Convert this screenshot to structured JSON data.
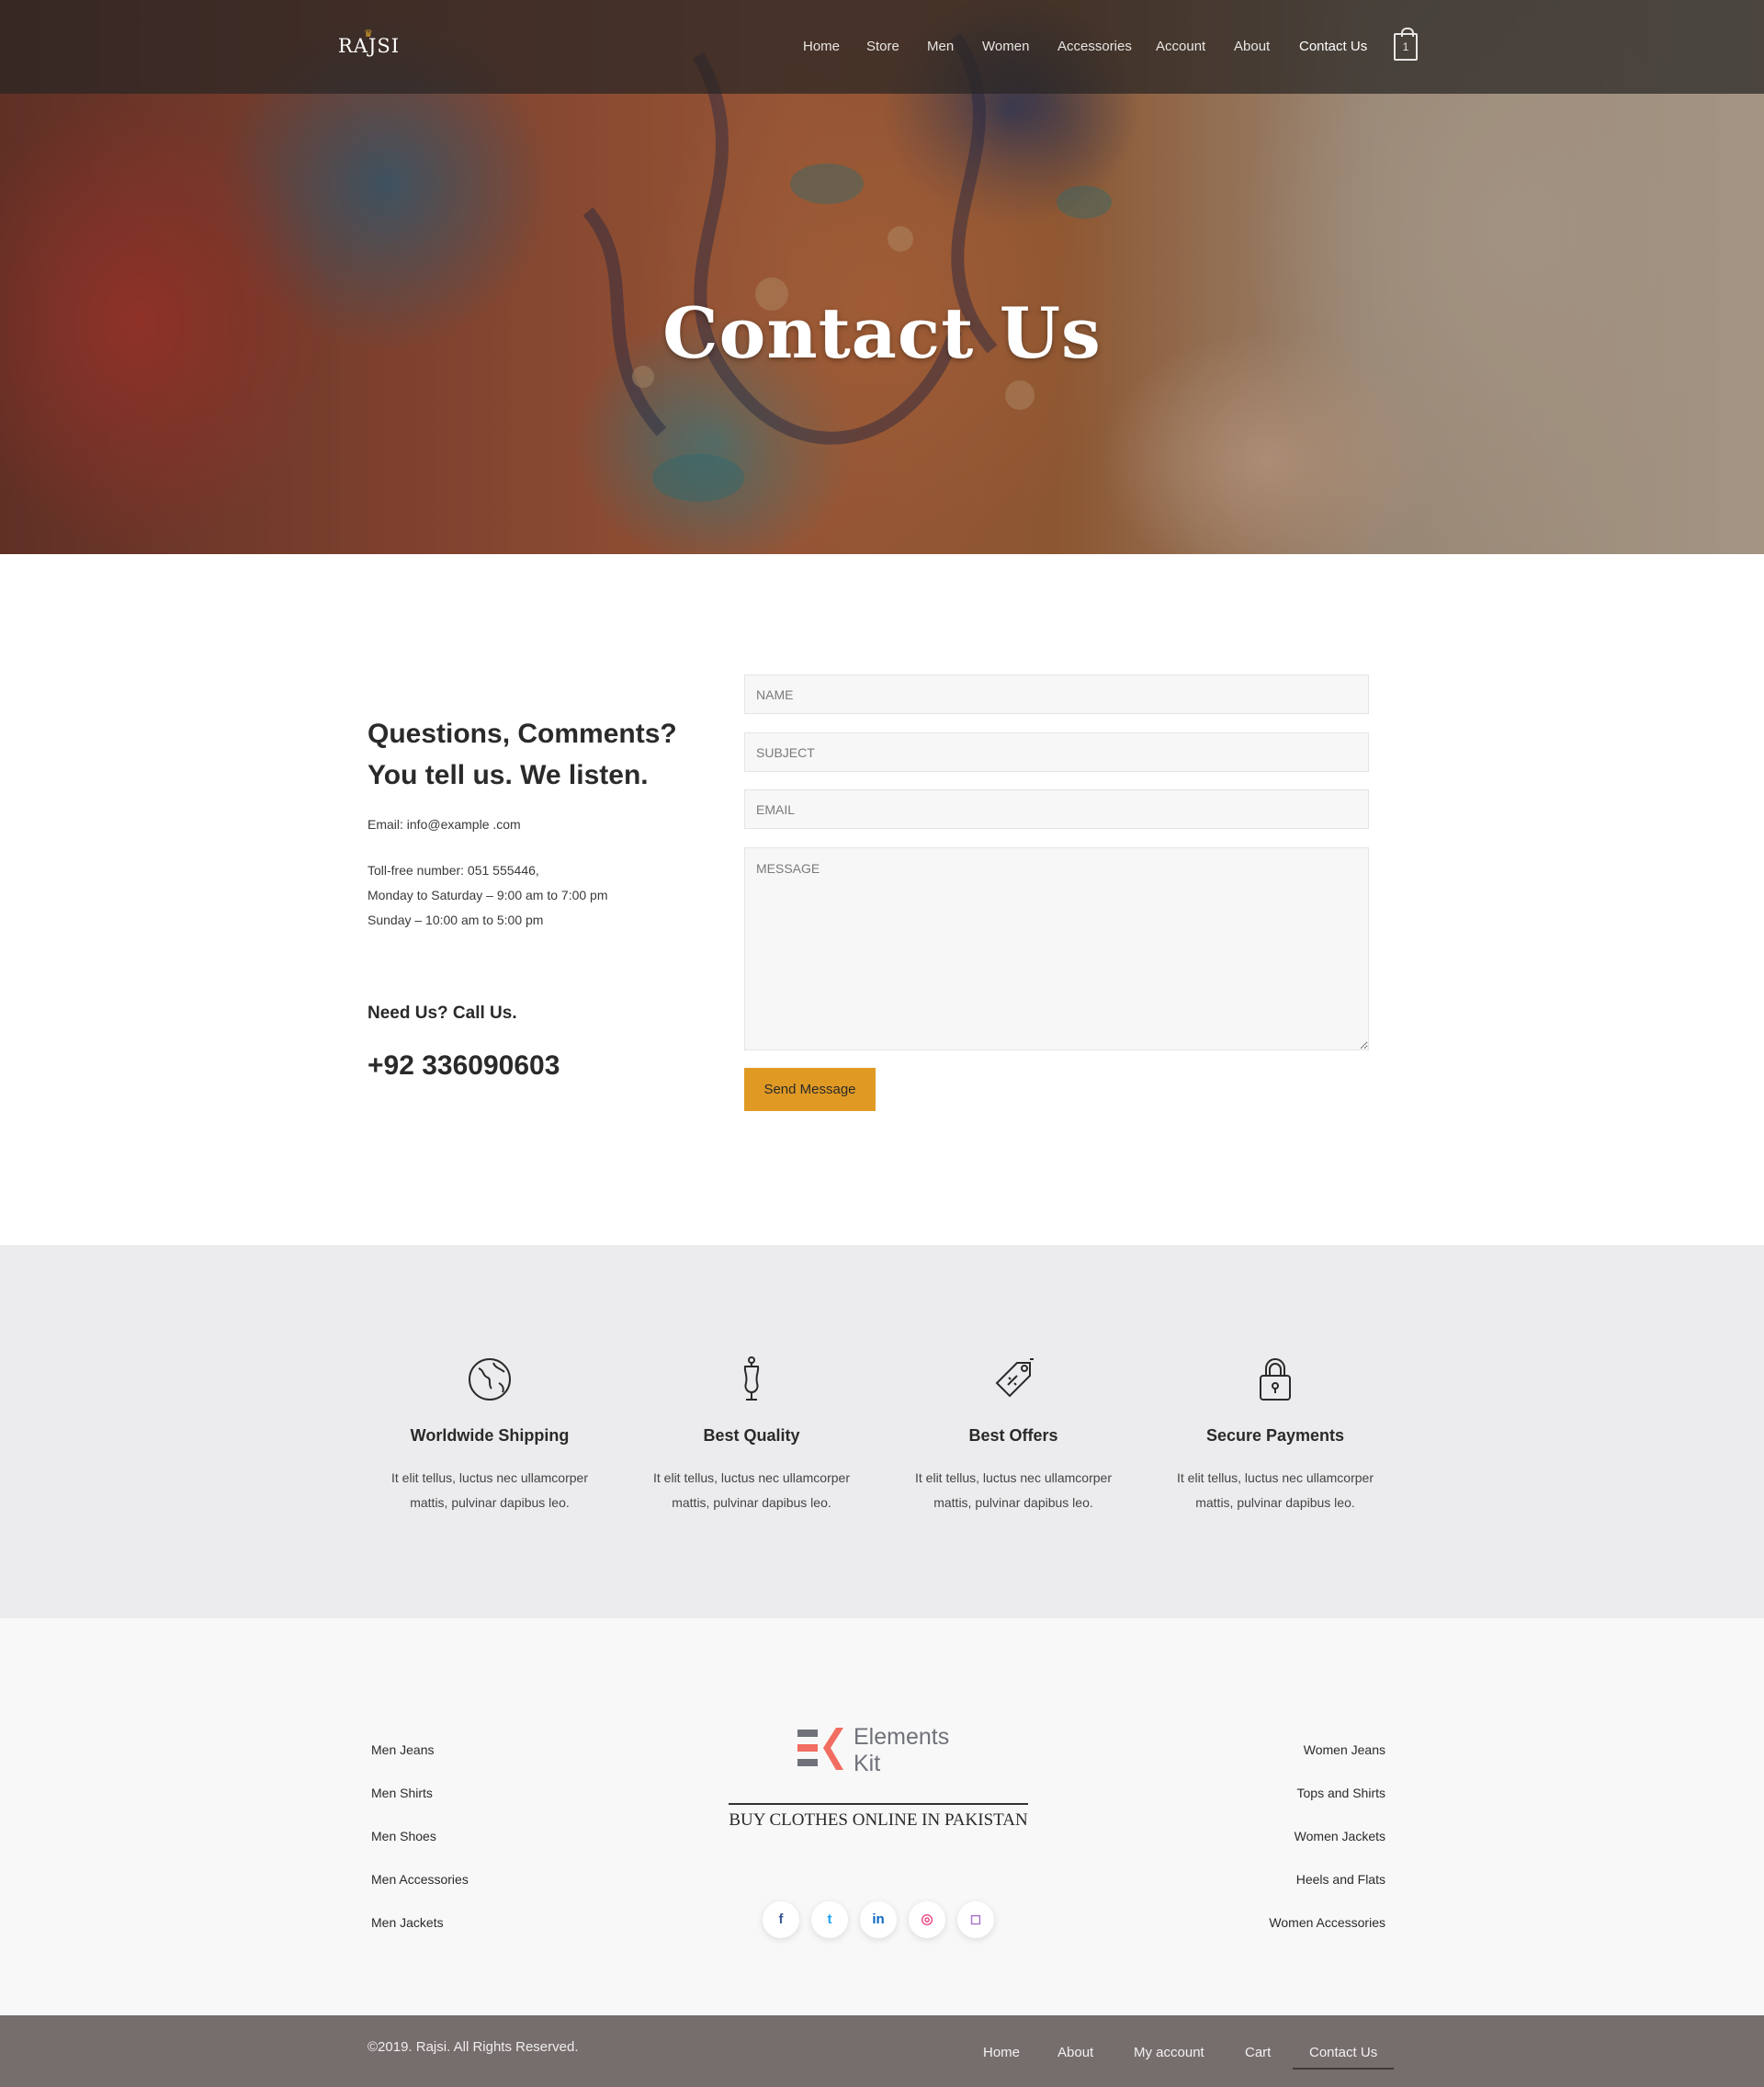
{
  "header": {
    "logo": "RAJSI",
    "nav": [
      "Home",
      "Store",
      "Men",
      "Women",
      "Accessories",
      "Account",
      "About",
      "Contact Us"
    ],
    "active_nav": "Contact Us",
    "cart_count": "1"
  },
  "hero": {
    "title": "Contact Us"
  },
  "contact": {
    "heading_line1": "Questions, Comments?",
    "heading_line2": "You tell us. We listen.",
    "email": "Email: info@example .com",
    "tollfree": "Toll-free number: 051 555446,",
    "hours_weekday": "Monday to Saturday – 9:00 am to 7:00 pm",
    "hours_sunday": "Sunday – 10:00 am to 5:00 pm",
    "need_us": "Need Us? Call Us.",
    "phone": "+92 336090603"
  },
  "form": {
    "name_placeholder": "Name",
    "subject_placeholder": "Subject",
    "email_placeholder": "Email",
    "message_placeholder": "Message",
    "submit_label": "Send Message"
  },
  "features": [
    {
      "icon": "globe-icon",
      "title": "Worldwide Shipping",
      "text": "It elit tellus, luctus nec ullamcorper mattis, pulvinar dapibus leo."
    },
    {
      "icon": "mannequin-icon",
      "title": "Best Quality",
      "text": "It elit tellus, luctus nec ullamcorper mattis, pulvinar dapibus leo."
    },
    {
      "icon": "price-tag-icon",
      "title": "Best Offers",
      "text": "It elit tellus, luctus nec ullamcorper mattis, pulvinar dapibus leo."
    },
    {
      "icon": "lock-icon",
      "title": "Secure Payments",
      "text": "It elit tellus, luctus nec ullamcorper mattis, pulvinar dapibus leo."
    }
  ],
  "footer": {
    "left_links": [
      "Men Jeans",
      "Men Shirts",
      "Men Shoes",
      "Men Accessories",
      "Men Jackets"
    ],
    "right_links": [
      "Women Jeans",
      "Tops and Shirts",
      "Women Jackets",
      "Heels and Flats",
      "Women Accessories"
    ],
    "brand_line1": "Elements",
    "brand_line2": "Kit",
    "tagline": "BUY CLOTHES ONLINE IN PAKISTAN",
    "social": [
      {
        "icon": "facebook-icon",
        "glyph": "f",
        "color": "#3b5998"
      },
      {
        "icon": "twitter-icon",
        "glyph": "t",
        "color": "#1da1f2"
      },
      {
        "icon": "linkedin-icon",
        "glyph": "in",
        "color": "#0a66c2"
      },
      {
        "icon": "dribbble-icon",
        "glyph": "◎",
        "color": "#ea4c89"
      },
      {
        "icon": "instagram-icon",
        "glyph": "◻",
        "color": "#a974c9"
      }
    ],
    "copyright": "©2019. Rajsi. All Rights Reserved.",
    "bottom_nav": [
      "Home",
      "About",
      "My account",
      "Cart",
      "Contact Us"
    ],
    "bottom_active": "Contact Us"
  },
  "colors": {
    "accent": "#e09a24",
    "bottom_bar": "#766e6c",
    "features_bg": "#ececee"
  }
}
